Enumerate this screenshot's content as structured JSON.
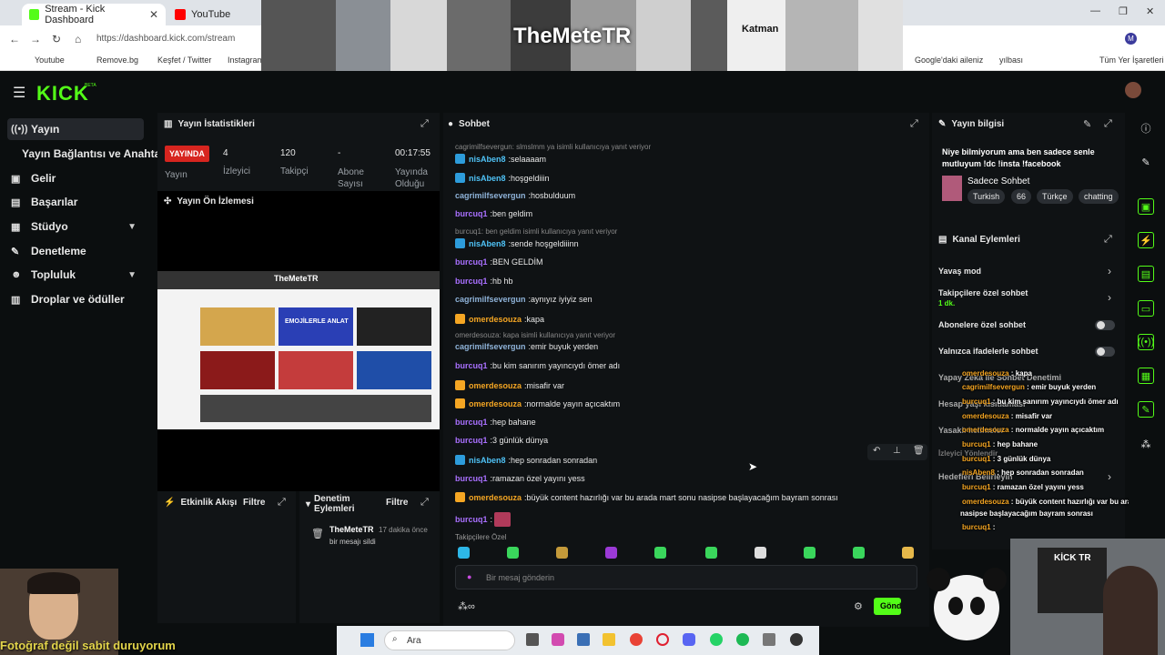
{
  "browser": {
    "tabs": [
      {
        "title": "Stream - Kick Dashboard",
        "color": "#53fc18"
      },
      {
        "title": "YouTube",
        "color": "#ff0000"
      }
    ],
    "url": "https://dashboard.kick.com/stream",
    "bookmarks": [
      "Youtube",
      "Remove.bg",
      "Keşfet / Twitter",
      "Instagram",
      "Google'daki aileniz",
      "yılbası",
      "Tüm Yer İşaretleri"
    ]
  },
  "overlay": {
    "title": "TheMeteTR",
    "katman": "Katman"
  },
  "app": {
    "logo": "KICK",
    "beta": "BETA",
    "accent": "#53fc18"
  },
  "sidebar": {
    "items": [
      {
        "label": "Yayın",
        "icon": "broadcast-icon"
      },
      {
        "label": "Yayın Bağlantısı ve Anahtarı",
        "icon": ""
      },
      {
        "label": "Gelir",
        "icon": "money-icon"
      },
      {
        "label": "Başarılar",
        "icon": "trophy-icon"
      },
      {
        "label": "Stüdyo",
        "icon": "studio-icon"
      },
      {
        "label": "Denetleme",
        "icon": "wrench-icon"
      },
      {
        "label": "Topluluk",
        "icon": "community-icon"
      },
      {
        "label": "Droplar ve ödüller",
        "icon": "gift-icon"
      }
    ]
  },
  "stats": {
    "title": "Yayın İstatistikleri",
    "live": "YAYINDA",
    "live_label": "Yayın",
    "viewers": "4",
    "viewers_label": "İzleyici",
    "followers": "120",
    "followers_label": "Takipçi",
    "subs": "-",
    "subs_label": "Abone Sayısı",
    "uptime": "00:17:55",
    "uptime_label": "Yayında Olduğu"
  },
  "preview": {
    "title": "Yayın Ön İzlemesi",
    "overlay_text": "TheMeteTR",
    "thumb_text": "EMOJİLERLE ANLAT"
  },
  "activity": {
    "title": "Etkinlik Akışı",
    "filter": "Filtre"
  },
  "modlog": {
    "title": "Denetim Eylemleri",
    "filter": "Filtre",
    "entry_user": "TheMeteTR",
    "entry_time": "17 dakika önce",
    "entry_text": "bir mesajı sildi"
  },
  "chat": {
    "title": "Sohbet",
    "messages": [
      {
        "type": "reply",
        "text": "cagrimilfsevergun: slmslmm ya isimli kullanıcıya yanıt veriyor"
      },
      {
        "user": "nisAben8",
        "text": "selaaaam",
        "color": "#4fc3f7",
        "badge": "#2d9cdb"
      },
      {
        "user": "nisAben8",
        "text": "hoşgeldiiin",
        "color": "#4fc3f7",
        "badge": "#2d9cdb"
      },
      {
        "user": "cagrimilfsevergun",
        "text": "hosbulduum",
        "color": "#8fb3d9"
      },
      {
        "user": "burcuq1",
        "text": "ben geldim",
        "color": "#a970ff"
      },
      {
        "type": "reply",
        "text": "burcuq1: ben geldim isimli kullanıcıya yanıt veriyor"
      },
      {
        "user": "nisAben8",
        "text": "sende hoşgeldiiinn",
        "color": "#4fc3f7",
        "badge": "#2d9cdb"
      },
      {
        "user": "burcuq1",
        "text": "BEN GELDİM",
        "color": "#a970ff"
      },
      {
        "user": "burcuq1",
        "text": "hb hb",
        "color": "#a970ff"
      },
      {
        "user": "cagrimilfsevergun",
        "text": "aynıyız iyiyiz sen",
        "color": "#8fb3d9"
      },
      {
        "user": "omerdesouza",
        "text": "kapa",
        "color": "#f5a623",
        "badge": "#f5a623"
      },
      {
        "type": "reply",
        "text": "omerdesouza: kapa isimli kullanıcıya yanıt veriyor"
      },
      {
        "user": "cagrimilfsevergun",
        "text": "emir buyuk yerden",
        "color": "#8fb3d9"
      },
      {
        "user": "burcuq1",
        "text": "bu kim sanırım yayıncıydı ömer adı",
        "color": "#a970ff"
      },
      {
        "user": "omerdesouza",
        "text": "misafir var",
        "color": "#f5a623",
        "badge": "#f5a623"
      },
      {
        "user": "omerdesouza",
        "text": "normalde yayın açıcaktım",
        "color": "#f5a623",
        "badge": "#f5a623"
      },
      {
        "user": "burcuq1",
        "text": "hep bahane",
        "color": "#a970ff"
      },
      {
        "user": "burcuq1",
        "text": "3 günlük dünya",
        "color": "#a970ff"
      },
      {
        "user": "nisAben8",
        "text": "hep sonradan sonradan",
        "color": "#4fc3f7",
        "badge": "#2d9cdb"
      },
      {
        "user": "burcuq1",
        "text": "ramazan özel yayını yess",
        "color": "#a970ff"
      },
      {
        "user": "omerdesouza",
        "text": "büyük content hazırlığı var bu arada mart sonu nasipse başlayacağım bayram sonrası",
        "color": "#f5a623",
        "badge": "#f5a623"
      },
      {
        "user": "burcuq1",
        "text": "",
        "color": "#a970ff"
      }
    ],
    "followers_only": "Takipçilere Özel",
    "placeholder": "Bir mesaj gönderin",
    "send": "Gönder"
  },
  "info": {
    "title": "Yayın bilgisi",
    "stream_title": "Niye bilmiyorum ama ben sadece senle mutluyum !dc !insta !facebook",
    "category": "Sadece Sohbet",
    "tags": [
      "Turkish",
      "66",
      "Türkçe",
      "chatting"
    ]
  },
  "channel_actions": {
    "title": "Kanal Eylemleri",
    "slow_mode": "Yavaş mod",
    "followers_chat": "Takipçilere özel sohbet",
    "followers_duration": "1 dk.",
    "subs_chat": "Abonelere özel sohbet",
    "emote_chat": "Yalnızca ifadelerle sohbet",
    "ai_mod": "Yapay Zeka ile Sohbet Denetimi",
    "h1": "Hesap yaşı kısıtlaması",
    "h2": "Yasaklı kelimeler",
    "h3": "İzleyici Yönlendir",
    "h4": "Hedefleri Belirleyin"
  },
  "overlay_chat": [
    {
      "user": "omerdesouza",
      "text": "kapa"
    },
    {
      "user": "cagrimilfsevergun",
      "text": "emir buyuk yerden"
    },
    {
      "user": "burcuq1",
      "text": "bu kim sanırım yayıncıydı ömer adı"
    },
    {
      "user": "omerdesouza",
      "text": "misafir var"
    },
    {
      "user": "omerdesouza",
      "text": "normalde yayın açıcaktım"
    },
    {
      "user": "burcuq1",
      "text": "hep bahane"
    },
    {
      "user": "burcuq1",
      "text": "3 günlük dünya"
    },
    {
      "user": "nisAben8",
      "text": "hep sonradan sonradan"
    },
    {
      "user": "burcuq1",
      "text": "ramazan özel yayını yess"
    },
    {
      "user": "omerdesouza",
      "text": "büyük content hazırlığı var bu arada mart sonu"
    },
    {
      "user": "",
      "text": "nasipse başlayacağım bayram sonrası"
    },
    {
      "user": "burcuq1",
      "text": ""
    }
  ],
  "caption": "Fotoğraf değil sabit duruyorum",
  "kick_tr": "KİCK TR",
  "taskbar": {
    "search": "Ara"
  }
}
